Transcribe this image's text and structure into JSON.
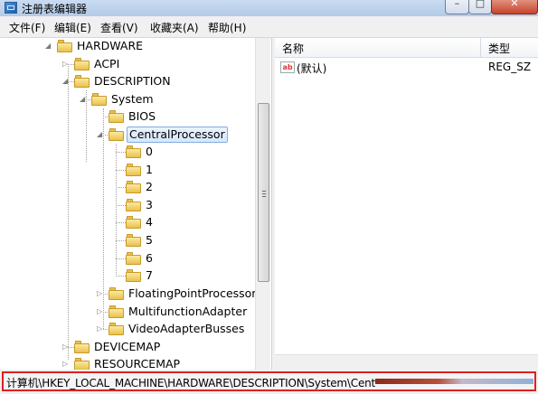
{
  "window": {
    "title": "注册表编辑器",
    "close_glyph": "✕",
    "min_glyph": "–",
    "max_glyph": "□"
  },
  "menu": [
    "文件(F)",
    "编辑(E)",
    "查看(V)",
    "收藏夹(A)",
    "帮助(H)"
  ],
  "tree": {
    "hardware": "HARDWARE",
    "acpi": "ACPI",
    "description": "DESCRIPTION",
    "system": "System",
    "bios": "BIOS",
    "centralprocessor": "CentralProcessor",
    "cpus": [
      "0",
      "1",
      "2",
      "3",
      "4",
      "5",
      "6",
      "7"
    ],
    "floatingpoint": "FloatingPointProcessor",
    "multifunction": "MultifunctionAdapter",
    "videoadapter": "VideoAdapterBusses",
    "devicemap": "DEVICEMAP",
    "resourcemap": "RESOURCEMAP"
  },
  "list": {
    "columns": {
      "name": "名称",
      "type": "类型"
    },
    "rows": [
      {
        "icon": "ab",
        "name": "(默认)",
        "type": "REG_SZ"
      }
    ]
  },
  "status": {
    "path": "计算机\\HKEY_LOCAL_MACHINE\\HARDWARE\\DESCRIPTION\\System\\Cent"
  },
  "colors": {
    "highlight_border": "#e02020",
    "selection": "#d6e7fb",
    "folder": "#e8c24c"
  },
  "icons": [
    "registry-editor-icon",
    "folder-icon",
    "string-value-icon"
  ]
}
